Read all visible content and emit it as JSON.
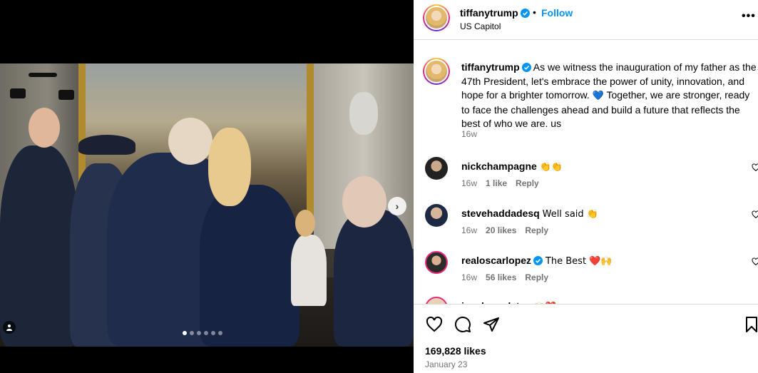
{
  "post": {
    "username": "tiffanytrump",
    "follow_label": "Follow",
    "separator": "•",
    "location": "US Capitol",
    "more_label": "•••"
  },
  "carousel": {
    "next_label": "›",
    "slide_count": 6,
    "active_index": 0
  },
  "caption": {
    "username": "tiffanytrump",
    "text_part1": "As we witness the inauguration of my father as the 47th President, let's embrace the power of unity, innovation, and hope for a brighter tomorrow.",
    "emoji_heart": "💙",
    "text_part2": "Together, we are stronger, ready to face the challenges ahead and build a future that reflects the best of who we are. us",
    "age": "16w"
  },
  "comments": [
    {
      "username": "nickchampagne",
      "text": "👏👏",
      "age": "16w",
      "likes": "1 like",
      "reply": "Reply"
    },
    {
      "username": "stevehaddadesq",
      "text": "Well said 👏",
      "age": "16w",
      "likes": "20 likes",
      "reply": "Reply"
    },
    {
      "username": "realoscarlopez",
      "text": "The Best ❤️🙌",
      "age": "16w",
      "likes": "56 likes",
      "reply": "Reply"
    },
    {
      "username": "ivankaundates",
      "text": "🙌❤️"
    }
  ],
  "footer": {
    "likes": "169,828 likes",
    "date": "January 23"
  },
  "colors": {
    "accent": "#0095f6",
    "muted": "#737373",
    "verified": "#0095f6",
    "border": "#dbdbdb"
  }
}
